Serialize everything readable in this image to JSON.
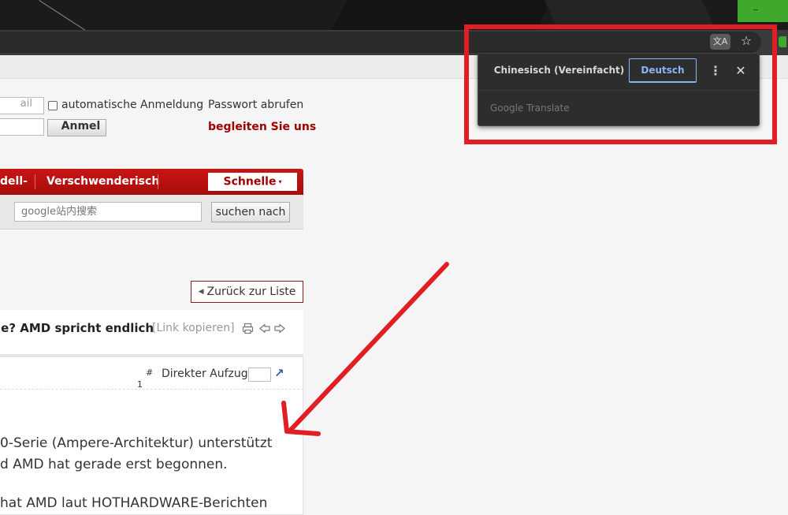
{
  "browser": {
    "window_minimize": "–",
    "translate_icon": "文A",
    "bookmark_star": "☆"
  },
  "translate_popup": {
    "source_language": "Chinesisch (Vereinfacht)",
    "target_language": "Deutsch",
    "more_menu": "⋮",
    "close": "✕",
    "footer": "Google Translate"
  },
  "login": {
    "email_placeholder": "ail",
    "auto_login_label": "automatische Anmeldung",
    "login_button": "Anmel",
    "retrieve_password": "Passwort abrufen",
    "join_us": "begleiten Sie uns"
  },
  "nav": {
    "items": [
      "dell-",
      "Verschwenderisch"
    ],
    "fast_menu": "Schnelle",
    "fast_caret": "▾"
  },
  "search": {
    "placeholder": "google站内搜索",
    "button": "suchen nach"
  },
  "thread": {
    "back_to_list": "Zurück zur Liste",
    "back_arrow": "◀",
    "title": "ie? AMD spricht endlich",
    "copy_link": "[Link kopieren]",
    "hash": "#",
    "post_number": "1",
    "jump_label": "Direkter Aufzug",
    "jump_go_icon": "↗",
    "body_lines": [
      "0-Serie (Ampere-Architektur) unterstützt",
      "d AMD hat gerade erst begonnen.",
      " hat AMD laut HOTHARDWARE-Berichten"
    ]
  },
  "colors": {
    "annotation_red": "#e01f25",
    "nav_red": "#b81010",
    "translate_blue": "#8ab4f8"
  }
}
